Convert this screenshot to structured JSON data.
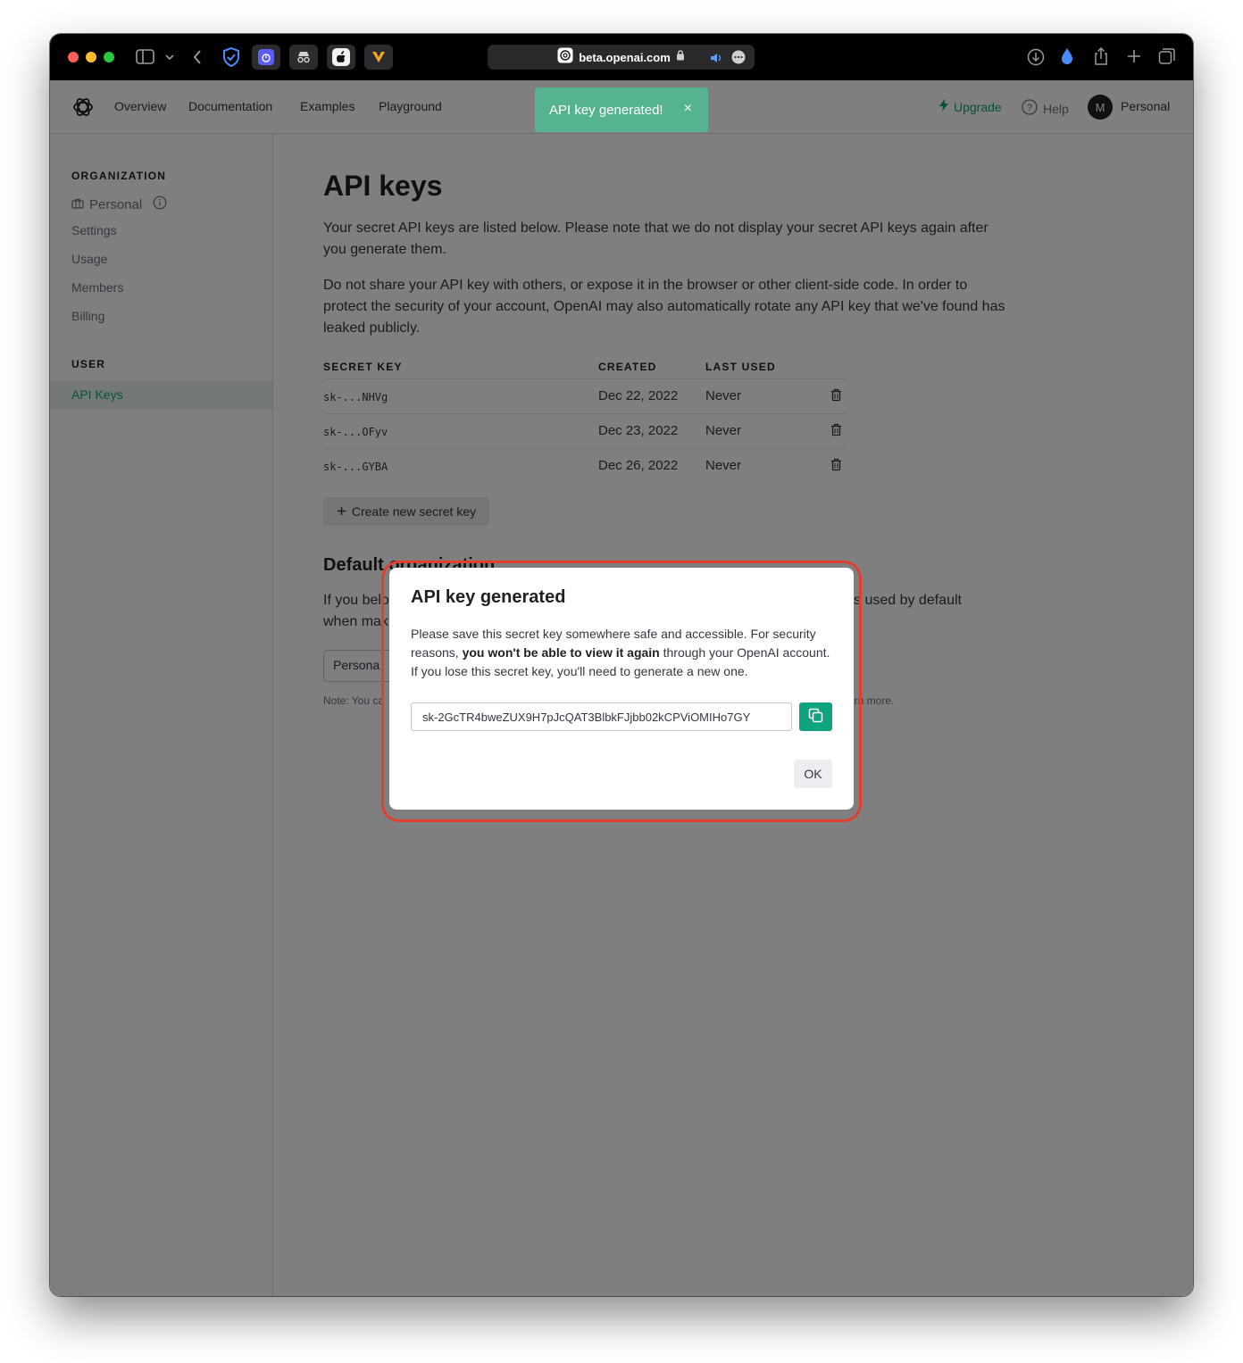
{
  "browser": {
    "url": "beta.openai.com"
  },
  "nav": {
    "links": [
      "Overview",
      "Documentation",
      "Examples",
      "Playground"
    ],
    "upgrade": "Upgrade",
    "help": "Help",
    "avatar_initial": "M",
    "account": "Personal"
  },
  "toast": {
    "message": "API key generated!",
    "close": "×"
  },
  "sidebar": {
    "org_heading": "ORGANIZATION",
    "org_name": "Personal",
    "org_items": [
      "Settings",
      "Usage",
      "Members",
      "Billing"
    ],
    "user_heading": "USER",
    "active_item": "API Keys"
  },
  "main": {
    "title": "API keys",
    "para1": "Your secret API keys are listed below. Please note that we do not display your secret API keys again after you generate them.",
    "para2": "Do not share your API key with others, or expose it in the browser or other client-side code. In order to protect the security of your account, OpenAI may also automatically rotate any API key that we've found has leaked publicly.",
    "columns": [
      "SECRET KEY",
      "CREATED",
      "LAST USED"
    ],
    "keys": [
      {
        "key": "sk-...NHVg",
        "created": "Dec 22, 2022",
        "last_used": "Never"
      },
      {
        "key": "sk-...OFyv",
        "created": "Dec 23, 2022",
        "last_used": "Never"
      },
      {
        "key": "sk-...GYBA",
        "created": "Dec 26, 2022",
        "last_used": "Never"
      }
    ],
    "create_button": "Create new secret key",
    "default_org_heading": "Default organization",
    "default_org_text_a": "If you belo",
    "default_org_text_b": "when mak",
    "default_org_text_c": "s used by default",
    "org_select_value": "Persona",
    "note_a": "Note: You ca",
    "note_b": "arn more."
  },
  "modal": {
    "title": "API key generated",
    "body_before": "Please save this secret key somewhere safe and accessible. For security reasons, ",
    "body_bold": "you won't be able to view it again",
    "body_after": " through your OpenAI account. If you lose this secret key, you'll need to generate a new one.",
    "key_value": "sk-2GcTR4bweZUX9H7pJcQAT3BlbkFJjbb02kCPViOMIHo7GY",
    "ok": "OK"
  },
  "colors": {
    "accent": "#10a37f",
    "toast": "#56b38f",
    "highlight": "#e03f2d"
  }
}
